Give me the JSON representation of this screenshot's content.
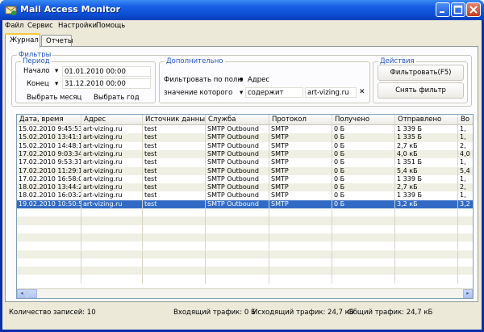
{
  "window": {
    "title": "Mail Access Monitor"
  },
  "menu": [
    "Файл",
    "Сервис",
    "Настройки",
    "Помощь"
  ],
  "tabs": [
    "Журнал",
    "Отчеты"
  ],
  "filters": {
    "group_title": "Фильтры",
    "period": {
      "title": "Период",
      "start_label": "Начало",
      "start_value": "01.01.2010 00:00",
      "end_label": "Конец",
      "end_value": "31.12.2010 00:00",
      "select_month": "Выбрать месяц",
      "select_year": "Выбрать год"
    },
    "extra": {
      "title": "Дополнительно",
      "filter_by_field_label": "Фильтровать по полю",
      "field_value": "Адрес",
      "value_label": "значение которого",
      "condition_value": "содержит",
      "text_value": "art-vizing.ru"
    },
    "actions": {
      "title": "Действия",
      "filter_button": "Фильтровать(F5)",
      "clear_button": "Снять фильтр"
    }
  },
  "table": {
    "columns": [
      "Дата, время",
      "Адрес",
      "Источник данных",
      "Служба",
      "Протокол",
      "Получено",
      "Отправлено",
      "Во"
    ],
    "rows": [
      [
        "15.02.2010 9:45:53",
        "art-vizing.ru",
        "test",
        "SMTP Outbound",
        "SMTP",
        "0 Б",
        "1 339 Б",
        "1,"
      ],
      [
        "15.02.2010 13:41:10",
        "art-vizing.ru",
        "test",
        "SMTP Outbound",
        "SMTP",
        "0 Б",
        "1 335 Б",
        "1,"
      ],
      [
        "15.02.2010 14:48:17",
        "art-vizing.ru",
        "test",
        "SMTP Outbound",
        "SMTP",
        "0 Б",
        "2,7 кБ",
        "2,"
      ],
      [
        "17.02.2010 9:03:34",
        "art-vizing.ru",
        "test",
        "SMTP Outbound",
        "SMTP",
        "0 Б",
        "4,0 кБ",
        "4,0"
      ],
      [
        "17.02.2010 9:53:31",
        "art-vizing.ru",
        "test",
        "SMTP Outbound",
        "SMTP",
        "0 Б",
        "1 351 Б",
        "1,"
      ],
      [
        "17.02.2010 11:29:14",
        "art-vizing.ru",
        "test",
        "SMTP Outbound",
        "SMTP",
        "0 Б",
        "5,4 кБ",
        "5,4"
      ],
      [
        "17.02.2010 16:58:00",
        "art-vizing.ru",
        "test",
        "SMTP Outbound",
        "SMTP",
        "0 Б",
        "1 339 Б",
        "1,"
      ],
      [
        "18.02.2010 13:44:21",
        "art-vizing.ru",
        "test",
        "SMTP Outbound",
        "SMTP",
        "0 Б",
        "2,7 кБ",
        "2,"
      ],
      [
        "18.02.2010 16:03:25",
        "art-vizing.ru",
        "test",
        "SMTP Outbound",
        "SMTP",
        "0 Б",
        "1 339 Б",
        "1,"
      ],
      [
        "19.02.2010 10:50:50",
        "art-vizing.ru",
        "test",
        "SMTP Outbound",
        "SMTP",
        "0 Б",
        "3,2 кБ",
        "3,2"
      ]
    ],
    "selected_row": 9
  },
  "status": {
    "records": "Количество записей: 10",
    "incoming": "Входящий трафик: 0 Б",
    "outgoing": "Исходящий трафик: 24,7 кБ",
    "total": "Общий трафик: 24,7 кБ"
  },
  "icons": [
    "app-icon",
    "minimize-icon",
    "maximize-icon",
    "close-icon",
    "clear-filter-icon",
    "scroll-left-icon",
    "scroll-right-icon"
  ],
  "colors": {
    "titlebar": "#0b4ed4",
    "selection": "#316ac5",
    "accent_title": "#2255c8"
  }
}
